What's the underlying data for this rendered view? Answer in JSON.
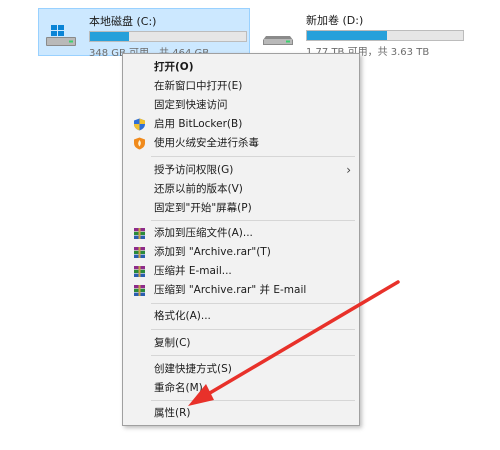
{
  "drives": {
    "c": {
      "name": "本地磁盘 (C:)",
      "info": "348 GB 可用，共 464 GB",
      "used_fraction": 0.25
    },
    "d": {
      "name": "新加卷 (D:)",
      "info": "1.77 TB 可用，共 3.63 TB",
      "used_fraction": 0.51
    }
  },
  "menu": {
    "open": "打开(O)",
    "open_new_window": "在新窗口中打开(E)",
    "pin_quick_access": "固定到快速访问",
    "bitlocker": "启用 BitLocker(B)",
    "antivirus": "使用火绒安全进行杀毒",
    "give_access": "授予访问权限(G)",
    "restore_versions": "还原以前的版本(V)",
    "pin_start": "固定到\"开始\"屏幕(P)",
    "add_archive": "添加到压缩文件(A)...",
    "add_archive_rar": "添加到 \"Archive.rar\"(T)",
    "compress_email": "压缩并 E-mail...",
    "compress_rar_email": "压缩到 \"Archive.rar\" 并 E-mail",
    "format": "格式化(A)...",
    "copy": "复制(C)",
    "create_shortcut": "创建快捷方式(S)",
    "rename": "重命名(M)",
    "properties": "属性(R)"
  },
  "colors": {
    "accent": "#26a0da",
    "selection_bg": "#cce8ff",
    "arrow": "#e8312a"
  }
}
